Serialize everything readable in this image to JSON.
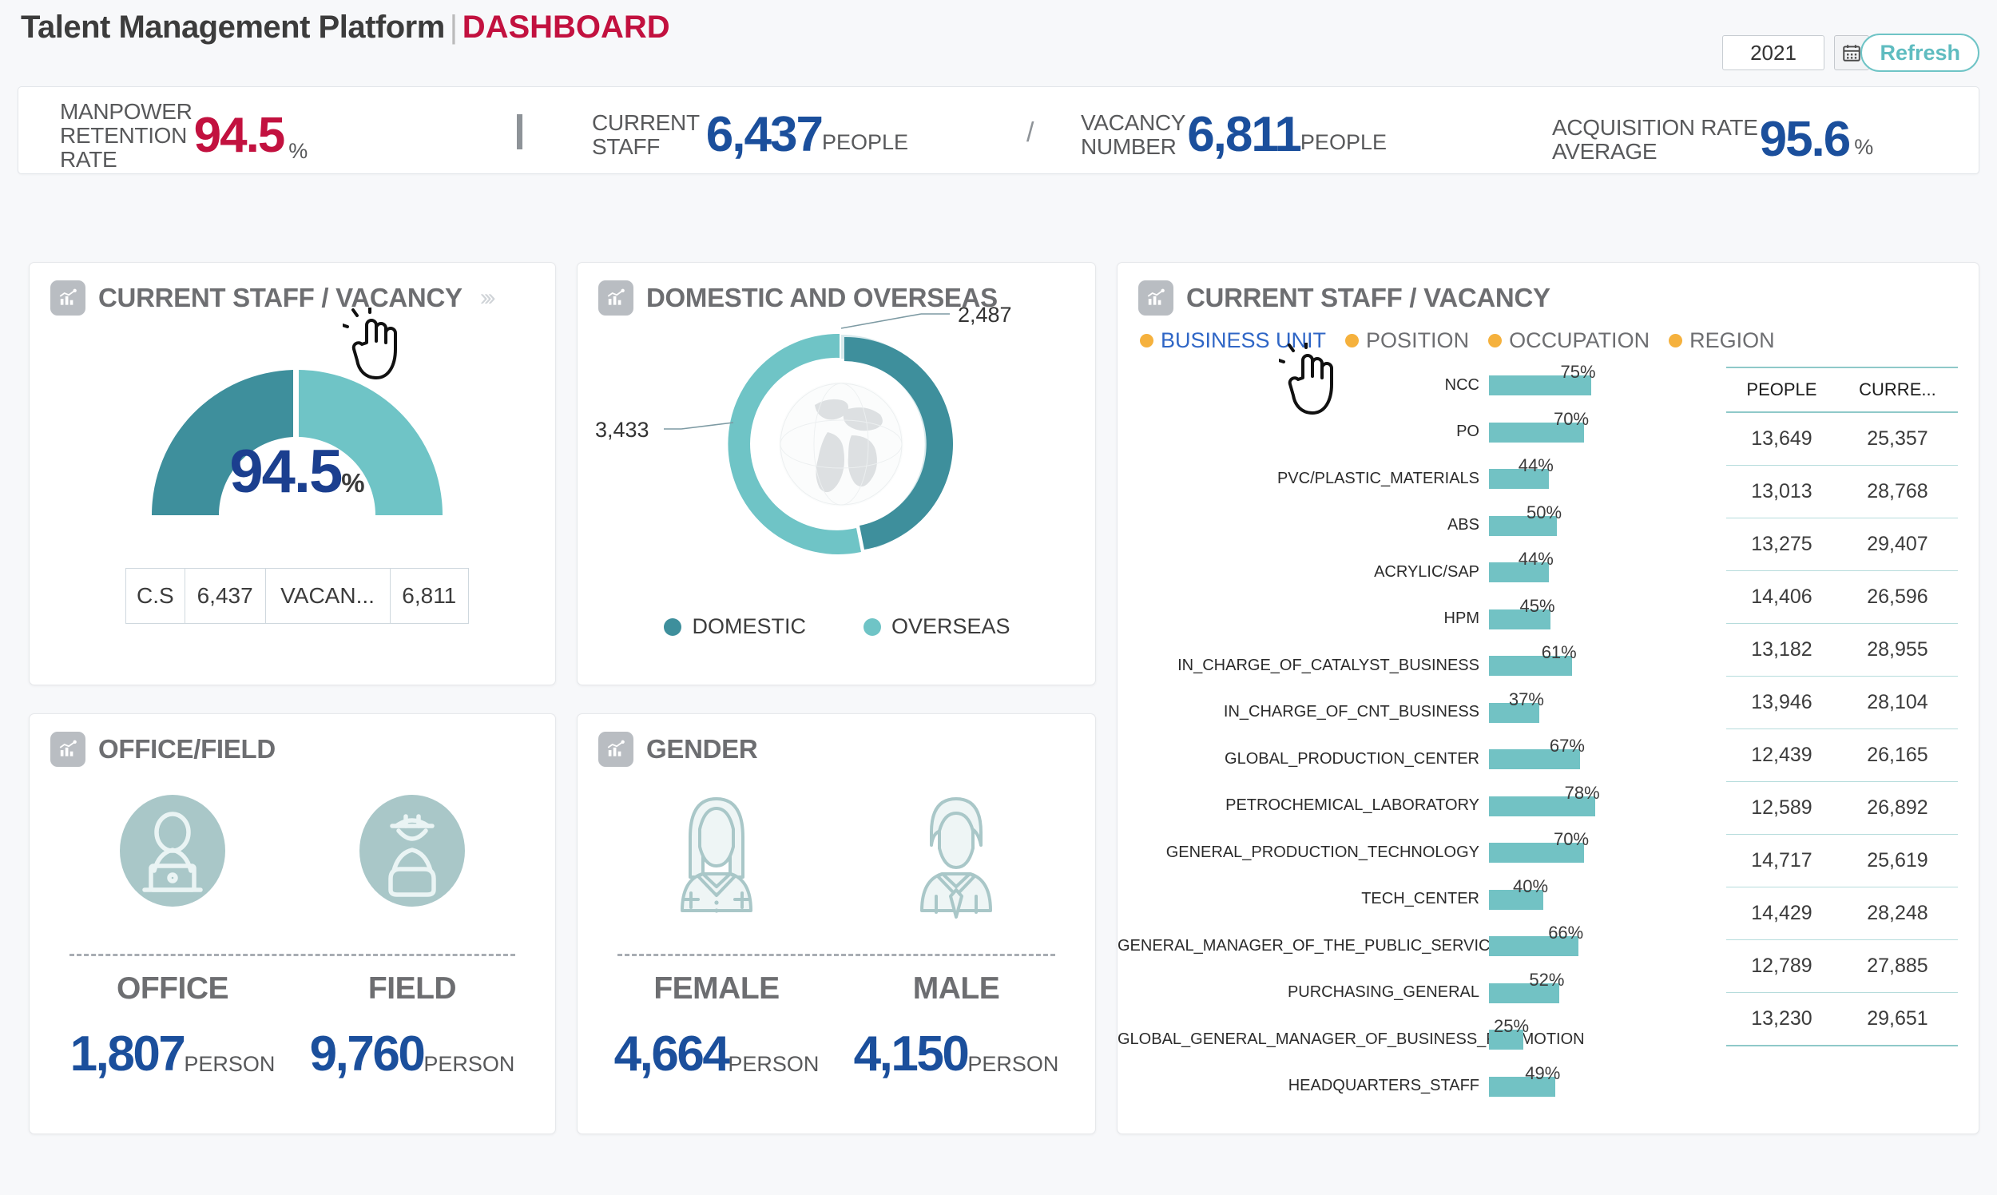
{
  "header": {
    "brand_main": "Talent Management Platform",
    "brand_divider": "|",
    "brand_accent": "DASHBOARD",
    "year_value": "2021",
    "calendar_icon": "calendar-icon",
    "refresh_label": "Refresh"
  },
  "kpis": [
    {
      "label": "MANPOWER\nRETENTION\nRATE",
      "value": "94.5",
      "unit": "%",
      "color": "#c2113f"
    },
    {
      "label": "CURRENT\nSTAFF",
      "value": "6,437",
      "unit": "PEOPLE",
      "color": "#1b4f9c"
    },
    {
      "label": "VACANCY\nNUMBER",
      "value": "6,811",
      "unit": "PEOPLE",
      "color": "#1b4f9c"
    },
    {
      "label": "ACQUISITION RATE\nAVERAGE",
      "value": "95.6",
      "unit": "%",
      "color": "#1b4f9c"
    }
  ],
  "kpi_slash": "/",
  "cards": {
    "gauge": {
      "title": "CURRENT STAFF / VACANCY",
      "chevron": "»›",
      "value": "94.5",
      "pct_sign": "%",
      "table": [
        {
          "label": "C.S",
          "value": "6,437"
        },
        {
          "label": "VACAN...",
          "value": "6,811"
        }
      ]
    },
    "donut": {
      "title": "DOMESTIC AND OVERSEAS",
      "label_overseas": "3,433",
      "label_domestic": "2,487",
      "legend": [
        {
          "name": "DOMESTIC",
          "color": "#3e8f9c"
        },
        {
          "name": "OVERSEAS",
          "color": "#6fc4c6"
        }
      ]
    },
    "office": {
      "title": "OFFICE/FIELD",
      "items": [
        {
          "icon": "office-worker-icon",
          "label": "OFFICE",
          "value": "1,807",
          "unit": "PERSON"
        },
        {
          "icon": "field-worker-icon",
          "label": "FIELD",
          "value": "9,760",
          "unit": "PERSON"
        }
      ]
    },
    "gender": {
      "title": "GENDER",
      "items": [
        {
          "icon": "female-avatar-icon",
          "label": "FEMALE",
          "value": "4,664",
          "unit": "PERSON"
        },
        {
          "icon": "male-avatar-icon",
          "label": "MALE",
          "value": "4,150",
          "unit": "PERSON"
        }
      ]
    },
    "bars": {
      "title": "CURRENT STAFF / VACANCY",
      "tabs": [
        {
          "label": "BUSINESS UNIT",
          "active": true
        },
        {
          "label": "POSITION",
          "active": false
        },
        {
          "label": "OCCUPATION",
          "active": false
        },
        {
          "label": "REGION",
          "active": false
        }
      ],
      "table_headers": [
        "PEOPLE",
        "CURRE..."
      ],
      "table_rows": [
        [
          "13,649",
          "25,357"
        ],
        [
          "13,013",
          "28,768"
        ],
        [
          "13,275",
          "29,407"
        ],
        [
          "14,406",
          "26,596"
        ],
        [
          "13,182",
          "28,955"
        ],
        [
          "13,946",
          "28,104"
        ],
        [
          "12,439",
          "26,165"
        ],
        [
          "12,589",
          "26,892"
        ],
        [
          "14,717",
          "25,619"
        ],
        [
          "14,429",
          "28,248"
        ],
        [
          "12,789",
          "27,885"
        ],
        [
          "13,230",
          "29,651"
        ]
      ]
    }
  },
  "chart_data": [
    {
      "type": "pie",
      "title": "CURRENT STAFF / VACANCY",
      "labels": [
        "CURRENT STAFF",
        "VACANCY"
      ],
      "values": [
        6437,
        6811
      ],
      "center_label": "94.5%",
      "colors": [
        "#3e8f9c",
        "#6fc4c6"
      ],
      "legend": "none",
      "note": "semicircle gauge"
    },
    {
      "type": "pie",
      "title": "DOMESTIC AND OVERSEAS",
      "labels": [
        "DOMESTIC",
        "OVERSEAS"
      ],
      "values": [
        2487,
        3433
      ],
      "colors": [
        "#3e8f9c",
        "#6fc4c6"
      ],
      "legend": "bottom",
      "note": "donut with globe center"
    },
    {
      "type": "bar",
      "title": "CURRENT STAFF / VACANCY",
      "orientation": "horizontal",
      "xlabel": "",
      "ylabel": "",
      "xlim": [
        0,
        100
      ],
      "grid": false,
      "legend": "none",
      "bar_color": "#72c2c4",
      "categories": [
        "NCC",
        "PO",
        "PVC/PLASTIC_MATERIALS",
        "ABS",
        "ACRYLIC/SAP",
        "HPM",
        "IN_CHARGE_OF_CATALYST_BUSINESS",
        "IN_CHARGE_OF_CNT_BUSINESS",
        "GLOBAL_PRODUCTION_CENTER",
        "PETROCHEMICAL_LABORATORY",
        "GENERAL_PRODUCTION_TECHNOLOGY",
        "TECH_CENTER",
        "GENERAL_MANAGER_OF_THE_PUBLIC_SERVICE",
        "PURCHASING_GENERAL",
        "GLOBAL_GENERAL_MANAGER_OF_BUSINESS_PROMOTION",
        "HEADQUARTERS_STAFF"
      ],
      "values": [
        75,
        70,
        44,
        50,
        44,
        45,
        61,
        37,
        67,
        78,
        70,
        40,
        66,
        52,
        25,
        49
      ],
      "value_labels": [
        "75%",
        "70%",
        "44%",
        "50%",
        "44%",
        "45%",
        "61%",
        "37%",
        "67%",
        "78%",
        "70%",
        "40%",
        "66%",
        "52%",
        "25%",
        "49%"
      ]
    }
  ]
}
